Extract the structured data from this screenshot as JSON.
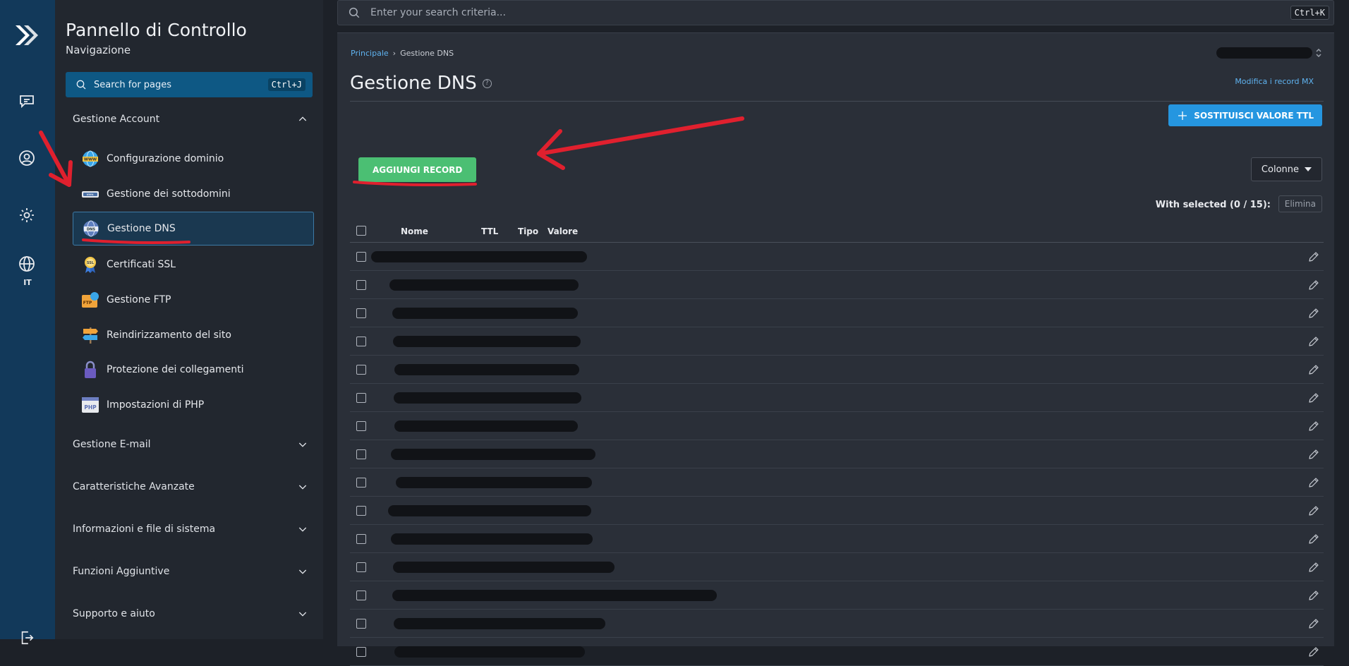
{
  "sidebar": {
    "title": "Pannello di Controllo",
    "subtitle": "Navigazione",
    "search_placeholder": "Search for pages",
    "search_shortcut": "Ctrl+J",
    "rail_lang": "IT",
    "sections": [
      {
        "label": "Gestione Account",
        "expanded": true
      },
      {
        "label": "Gestione E-mail",
        "expanded": false
      },
      {
        "label": "Caratteristiche Avanzate",
        "expanded": false
      },
      {
        "label": "Informazioni e file di sistema",
        "expanded": false
      },
      {
        "label": "Funzioni Aggiuntive",
        "expanded": false
      },
      {
        "label": "Supporto e aiuto",
        "expanded": false
      }
    ],
    "account_items": [
      {
        "label": "Configurazione dominio",
        "icon": "www-globe-icon"
      },
      {
        "label": "Gestione dei sottodomini",
        "icon": "subdomain-bar-icon"
      },
      {
        "label": "Gestione DNS",
        "icon": "dns-globe-icon",
        "active": true
      },
      {
        "label": "Certificati SSL",
        "icon": "ssl-badge-icon"
      },
      {
        "label": "Gestione FTP",
        "icon": "ftp-folder-icon"
      },
      {
        "label": "Reindirizzamento del sito",
        "icon": "signpost-icon"
      },
      {
        "label": "Protezione dei collegamenti",
        "icon": "lock-icon"
      },
      {
        "label": "Impostazioni di PHP",
        "icon": "php-icon"
      }
    ]
  },
  "topbar": {
    "search_placeholder": "Enter your search criteria...",
    "search_shortcut": "Ctrl+K"
  },
  "main": {
    "breadcrumb": [
      "Principale",
      "Gestione DNS"
    ],
    "title": "Gestione DNS",
    "mx_link": "Modifica i record MX",
    "ttl_button": "SOSTITUISCI VALORE TTL",
    "add_button": "AGGIUNGI RECORD",
    "columns_button": "Colonne",
    "with_selected": "With selected (0 / 15):",
    "delete_button": "Elimina",
    "table_headers": [
      "Nome",
      "TTL",
      "Tipo",
      "Valore"
    ],
    "row_count_visible": 15
  },
  "colors": {
    "rail": "#12395a",
    "sidebar": "#22272f",
    "accent_blue": "#2596e0",
    "add_green": "#4bbf73",
    "annotation_red": "#e0202e"
  }
}
